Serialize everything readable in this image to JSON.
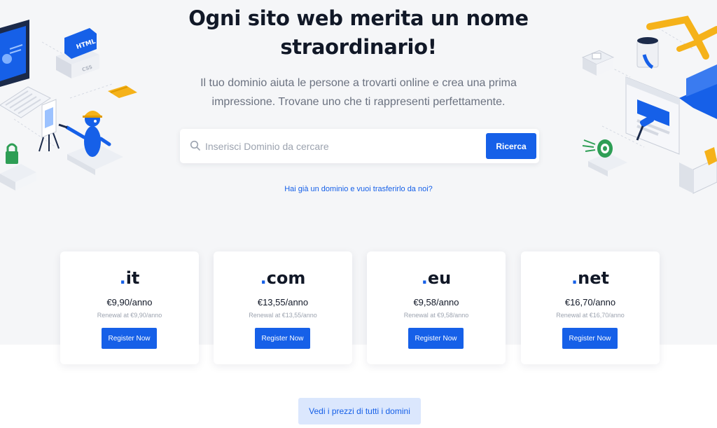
{
  "hero": {
    "title": "Ogni sito web merita un nome straordinario!",
    "subtitle": "Il tuo dominio aiuta le persone a trovarti online e crea una prima impressione. Trovane uno che ti rappresenti perfettamente."
  },
  "search": {
    "placeholder": "Inserisci Dominio da cercare",
    "value": "",
    "button_label": "Ricerca",
    "icon": "search-icon"
  },
  "transfer_link": "Hai già un dominio e vuoi trasferirlo da noi?",
  "domains": [
    {
      "dot": ".",
      "ext": "it",
      "price": "€9,90/anno",
      "renewal": "Renewal at €9,90/anno",
      "button_label": "Register Now"
    },
    {
      "dot": ".",
      "ext": "com",
      "price": "€13,55/anno",
      "renewal": "Renewal at €13,55/anno",
      "button_label": "Register Now"
    },
    {
      "dot": ".",
      "ext": "eu",
      "price": "€9,58/anno",
      "renewal": "Renewal at €9,58/anno",
      "button_label": "Register Now"
    },
    {
      "dot": ".",
      "ext": "net",
      "price": "€16,70/anno",
      "renewal": "Renewal at €16,70/anno",
      "button_label": "Register Now"
    }
  ],
  "all_prices_button": "Vedi i prezzi di tutti i domini",
  "illustration_labels": {
    "html": "HTML",
    "css": "CSS"
  },
  "colors": {
    "accent": "#1660e8",
    "accent_light": "#dbe7fd",
    "hero_bg": "#f5f6f8",
    "title": "#111827",
    "muted": "#6b7280",
    "helmet_yellow": "#f5b21a"
  }
}
